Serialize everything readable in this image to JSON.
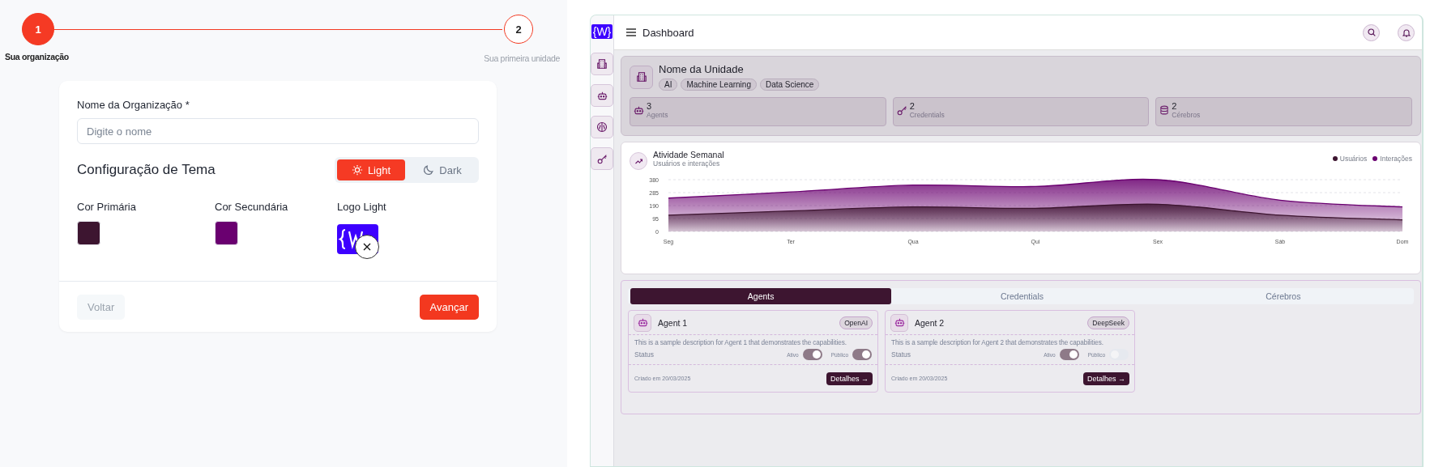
{
  "stepper": {
    "steps": [
      {
        "number": "1",
        "label": "Sua organização",
        "selected": true
      },
      {
        "number": "2",
        "label": "Sua primeira unidade",
        "selected": false
      }
    ]
  },
  "form": {
    "name_label": "Nome da Organização *",
    "name_placeholder": "Digite o nome",
    "theme_title": "Configuração de Tema",
    "theme_options": [
      {
        "label": "Light",
        "kind": "sun",
        "selected": true
      },
      {
        "label": "Dark",
        "kind": "moon",
        "selected": false
      }
    ],
    "colors": [
      {
        "label": "Cor Primária",
        "color": "#3d1530"
      },
      {
        "label": "Cor Secundária",
        "color": "#6a0070"
      }
    ],
    "logo_label": "Logo Light",
    "buttons": [
      {
        "label": "Voltar",
        "kind": "secondary",
        "disabled": true
      },
      {
        "label": "Avançar",
        "kind": "primary",
        "disabled": false
      }
    ]
  },
  "preview": {
    "logo": "{W}",
    "title": "Dashboard",
    "sidebar_items": [
      {
        "kind": "building"
      },
      {
        "kind": "robot"
      },
      {
        "kind": "brain"
      },
      {
        "kind": "key"
      }
    ],
    "unit": {
      "name": "Nome da Unidade",
      "tags": [
        "AI",
        "Machine Learning",
        "Data Science"
      ],
      "stats": [
        {
          "kind": "robot",
          "value": "3",
          "label": "Agents"
        },
        {
          "kind": "key",
          "value": "2",
          "label": "Credentials"
        },
        {
          "kind": "database",
          "value": "2",
          "label": "Cérebros"
        }
      ]
    },
    "activity": {
      "title": "Atividade Semanal",
      "subtitle": "Usuários e interações",
      "chart_data": {
        "type": "area",
        "categories": [
          "Seg",
          "Ter",
          "Qua",
          "Qui",
          "Sex",
          "Sáb",
          "Dom"
        ],
        "ylim": [
          0,
          380
        ],
        "yticks": [
          0,
          95,
          190,
          285,
          380
        ],
        "stacked": false,
        "grid": true,
        "series": [
          {
            "name": "Usuários",
            "color": "#3d1530",
            "values": [
              120,
              150,
              180,
              170,
              200,
              120,
              85
            ]
          },
          {
            "name": "Interações",
            "color": "#6a0070",
            "values": [
              245,
              290,
              340,
              330,
              380,
              230,
              180
            ]
          }
        ]
      }
    },
    "tabs": [
      {
        "label": "Agents",
        "selected": true
      },
      {
        "label": "Credentials",
        "selected": false
      },
      {
        "label": "Cérebros",
        "selected": false
      }
    ],
    "agents": [
      {
        "name": "Agent 1",
        "provider": "OpenAI",
        "description": "This is a sample description for Agent 1 that demonstrates the capabilities.",
        "status_label": "Status",
        "toggles": [
          {
            "label": "Ativo",
            "on": true
          },
          {
            "label": "Público",
            "on": true
          }
        ],
        "created": "Criado em 20/03/2025",
        "action": "Detalhes →"
      },
      {
        "name": "Agent 2",
        "provider": "DeepSeek",
        "description": "This is a sample description for Agent 2 that demonstrates the capabilities.",
        "status_label": "Status",
        "toggles": [
          {
            "label": "Ativo",
            "on": true
          },
          {
            "label": "Público",
            "on": false
          }
        ],
        "created": "Criado em 20/03/2025",
        "action": "Detalhes →"
      }
    ]
  }
}
